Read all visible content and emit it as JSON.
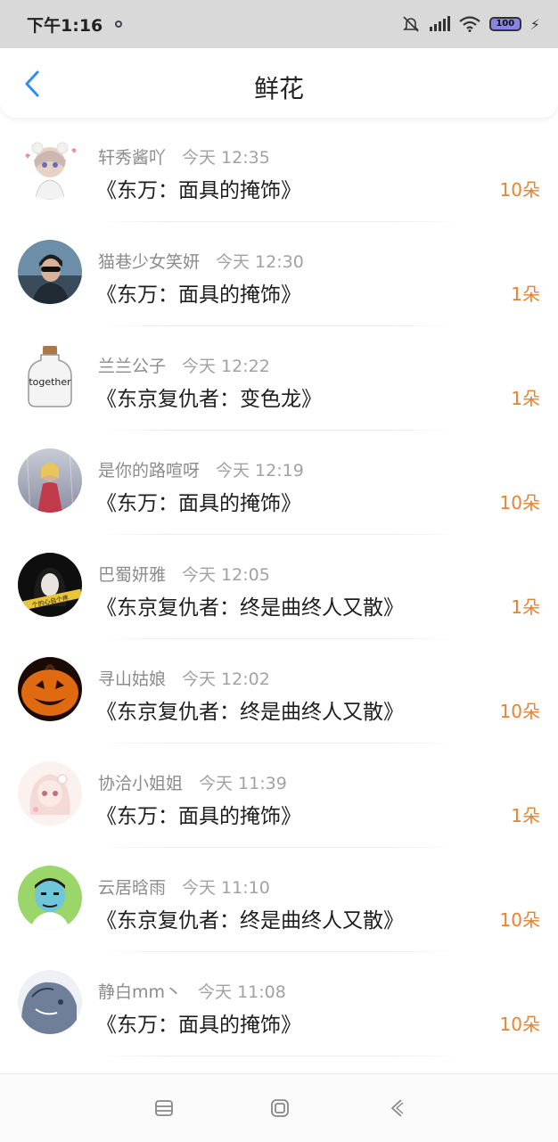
{
  "status_bar": {
    "time": "下午1:16",
    "battery": "100",
    "icons": [
      "mute-bell-icon",
      "signal-icon",
      "wifi-icon",
      "battery-icon",
      "charging-icon"
    ]
  },
  "header": {
    "title": "鲜花",
    "back_icon": "chevron-left-icon"
  },
  "items": [
    {
      "name": "轩秀酱吖",
      "time": "今天 12:35",
      "title": "《东万：面具的掩饰》",
      "count": "10朵"
    },
    {
      "name": "猫巷少女笑妍",
      "time": "今天 12:30",
      "title": "《东万：面具的掩饰》",
      "count": "1朵"
    },
    {
      "name": "兰兰公子",
      "time": "今天 12:22",
      "title": "《东京复仇者：变色龙》",
      "count": "1朵"
    },
    {
      "name": "是你的路喧呀",
      "time": "今天 12:19",
      "title": "《东万：面具的掩饰》",
      "count": "10朵"
    },
    {
      "name": "巴蜀妍雅",
      "time": "今天 12:05",
      "title": "《东京复仇者：终是曲终人又散》",
      "count": "1朵"
    },
    {
      "name": "寻山姑娘",
      "time": "今天 12:02",
      "title": "《东京复仇者：终是曲终人又散》",
      "count": "10朵"
    },
    {
      "name": "协洽小姐姐",
      "time": "今天 11:39",
      "title": "《东万：面具的掩饰》",
      "count": "1朵"
    },
    {
      "name": "云居晗雨",
      "time": "今天 11:10",
      "title": "《东京复仇者：终是曲终人又散》",
      "count": "10朵"
    },
    {
      "name": "静白mm丶",
      "time": "今天 11:08",
      "title": "《东万：面具的掩饰》",
      "count": "10朵"
    }
  ],
  "avatar_labels": {
    "bottle": "together",
    "banner": "个的心自个疼"
  },
  "nav_bar": {
    "icons": [
      "menu-icon",
      "home-square-icon",
      "back-triangle-icon"
    ]
  },
  "colors": {
    "accent": "#2e8ff0",
    "count": "#e8822e",
    "status_bar_bg": "#d9d9d9"
  }
}
